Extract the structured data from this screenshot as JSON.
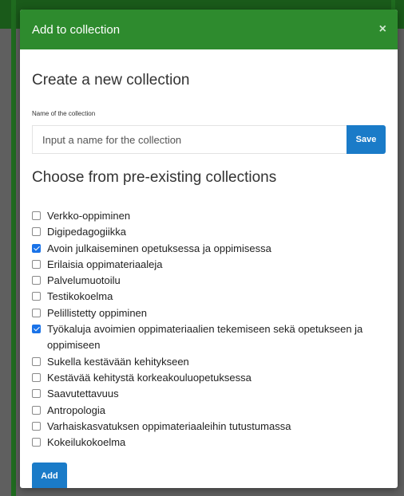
{
  "modal": {
    "title": "Add to collection",
    "close_symbol": "×",
    "create_heading": "Create a new collection",
    "name_label": "Name of the collection",
    "name_placeholder": "Input a name for the collection",
    "name_value": "",
    "save_label": "Save",
    "choose_heading": "Choose from pre-existing collections",
    "collections": [
      {
        "label": "Verkko-oppiminen",
        "checked": false
      },
      {
        "label": "Digipedagogiikka",
        "checked": false
      },
      {
        "label": "Avoin julkaiseminen opetuksessa ja oppimisessa",
        "checked": true
      },
      {
        "label": "Erilaisia oppimateriaaleja",
        "checked": false
      },
      {
        "label": "Palvelumuotoilu",
        "checked": false
      },
      {
        "label": "Testikokoelma",
        "checked": false
      },
      {
        "label": "Pelillistetty oppiminen",
        "checked": false
      },
      {
        "label": "Työkaluja avoimien oppimateriaalien tekemiseen sekä opetukseen ja oppimiseen",
        "checked": true
      },
      {
        "label": "Sukella kestävään kehitykseen",
        "checked": false
      },
      {
        "label": "Kestävää kehitystä korkeakouluopetuksessa",
        "checked": false
      },
      {
        "label": "Saavutettavuus",
        "checked": false
      },
      {
        "label": "Antropologia",
        "checked": false
      },
      {
        "label": "Varhaiskasvatuksen oppimateriaaleihin tutustumassa",
        "checked": false
      },
      {
        "label": "Kokeilukokoelma",
        "checked": false
      }
    ],
    "add_label": "Add"
  },
  "colors": {
    "header_green": "#2e8b2e",
    "button_blue": "#1a7bc8",
    "checkbox_checked": "#1a73e8"
  }
}
